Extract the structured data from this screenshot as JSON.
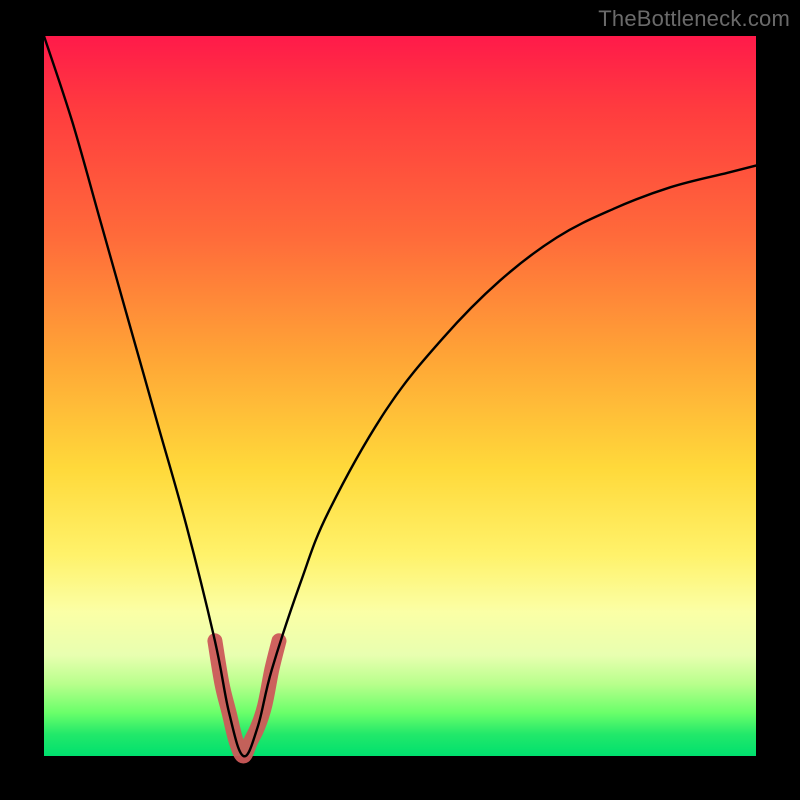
{
  "watermark": "TheBottleneck.com",
  "chart_data": {
    "type": "line",
    "title": "",
    "xlabel": "",
    "ylabel": "",
    "xlim": [
      0,
      100
    ],
    "ylim": [
      0,
      100
    ],
    "grid": false,
    "notes": "V-shaped bottleneck curve over red-to-green vertical gradient; minimum (optimal) around 28% on the x-axis.",
    "series": [
      {
        "name": "curve",
        "x": [
          0,
          4,
          8,
          12,
          16,
          20,
          24,
          26,
          28,
          30,
          32,
          36,
          40,
          48,
          56,
          64,
          72,
          80,
          88,
          96,
          100
        ],
        "y": [
          100,
          88,
          74,
          60,
          46,
          32,
          16,
          6,
          0,
          4,
          12,
          24,
          34,
          48,
          58,
          66,
          72,
          76,
          79,
          81,
          82
        ]
      }
    ],
    "highlight": {
      "name": "valley-marker",
      "x": [
        24,
        25,
        26,
        27,
        28,
        29,
        30,
        31,
        32,
        33
      ],
      "y": [
        16,
        10,
        6,
        2,
        0,
        2,
        4,
        7,
        12,
        16
      ]
    },
    "gradient_stops": [
      {
        "pos": 0,
        "color": "#ff1a4a"
      },
      {
        "pos": 45,
        "color": "#ffa636"
      },
      {
        "pos": 72,
        "color": "#fff26a"
      },
      {
        "pos": 100,
        "color": "#00e06e"
      }
    ]
  }
}
